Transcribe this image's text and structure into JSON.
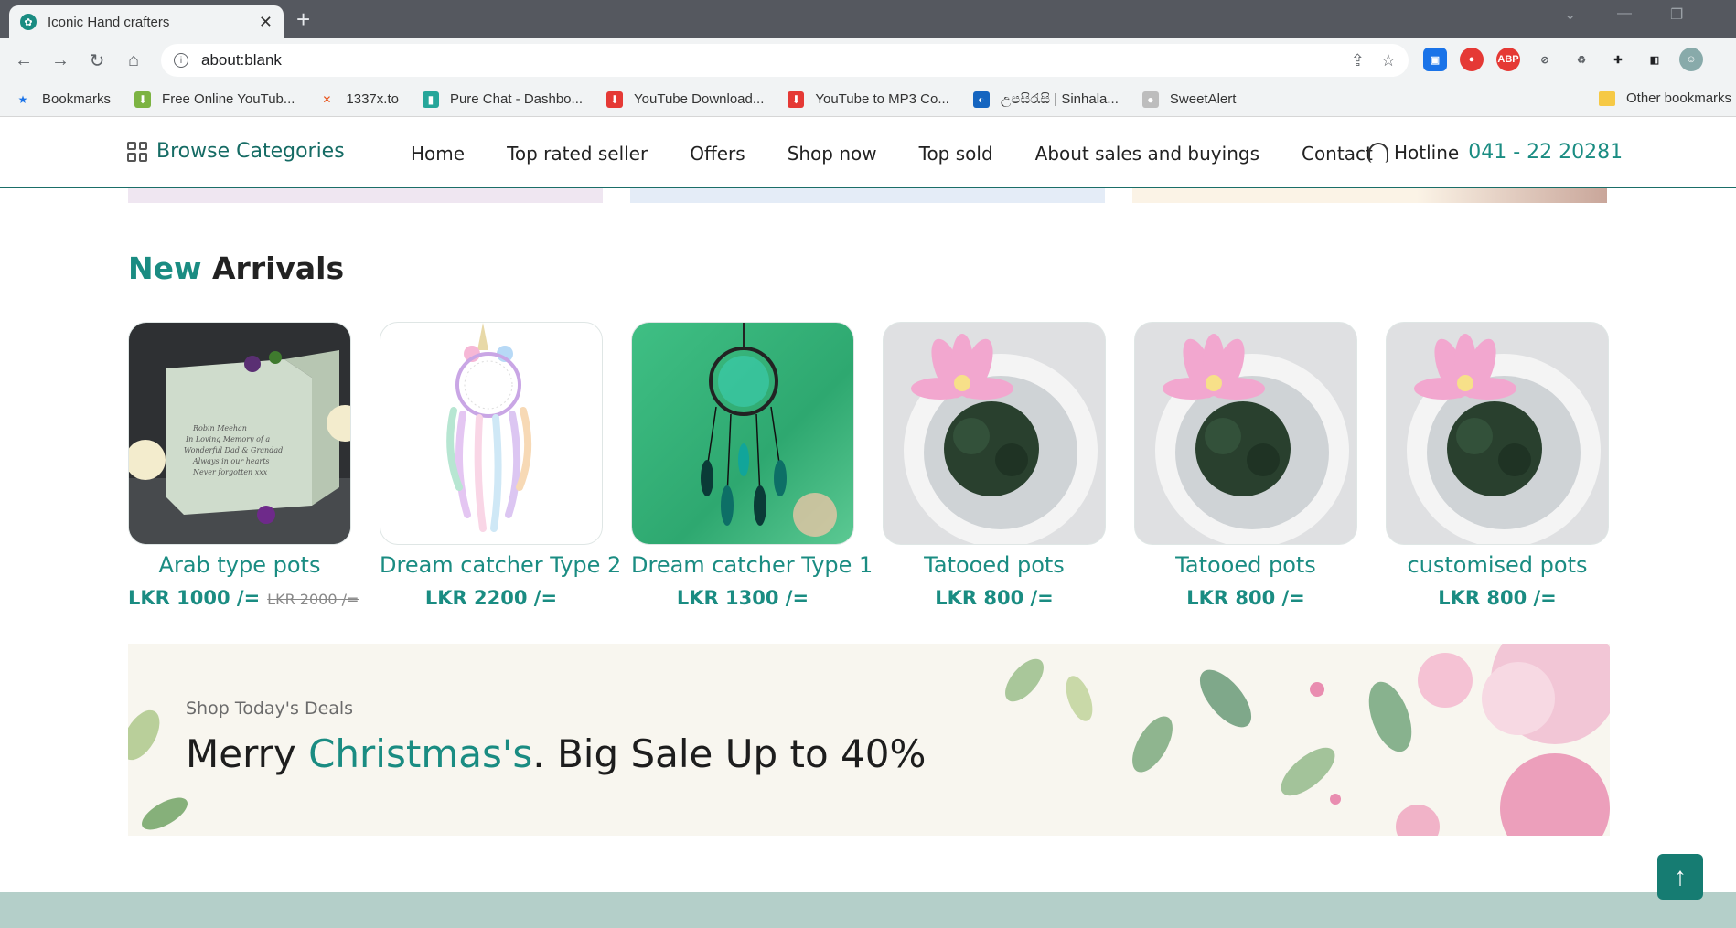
{
  "browser": {
    "tab_title": "Iconic Hand crafters",
    "url": "about:blank",
    "bookmarks": [
      {
        "label": "Bookmarks",
        "icon": "star-icon",
        "color": "#1a73e8"
      },
      {
        "label": "Free Online YouTub...",
        "icon": "download-icon",
        "color": "#7cb342"
      },
      {
        "label": "1337x.to",
        "icon": "x-icon",
        "color": "#e8541c"
      },
      {
        "label": "Pure Chat - Dashbo...",
        "icon": "chat-icon",
        "color": "#26a69a"
      },
      {
        "label": "YouTube Download...",
        "icon": "download-icon",
        "color": "#e53935"
      },
      {
        "label": "YouTube to MP3 Co...",
        "icon": "download-icon",
        "color": "#e53935"
      },
      {
        "label": "උපසිරැසි | Sinhala...",
        "icon": "site-icon",
        "color": "#1565c0"
      },
      {
        "label": "SweetAlert",
        "icon": "globe-icon",
        "color": "#bdbdbd"
      }
    ],
    "other_bookmarks": "Other bookmarks"
  },
  "header": {
    "browse_label": "Browse Categories",
    "nav": [
      "Home",
      "Top rated seller",
      "Offers",
      "Shop now",
      "Top sold",
      "About sales and buyings",
      "Contact"
    ],
    "hotline_label": "Hotline",
    "hotline_number": "041 - 22 20281"
  },
  "arrivals": {
    "title_accent": "New",
    "title_rest": "Arrivals",
    "products": [
      {
        "name": "Arab type pots",
        "price": "LKR 1000 /=",
        "old_price": "LKR 2000 /="
      },
      {
        "name": "Dream catcher Type 2",
        "price": "LKR 2200 /=",
        "old_price": ""
      },
      {
        "name": "Dream catcher Type 1",
        "price": "LKR 1300 /=",
        "old_price": ""
      },
      {
        "name": "Tatooed pots",
        "price": "LKR 800 /=",
        "old_price": ""
      },
      {
        "name": "Tatooed pots",
        "price": "LKR 800 /=",
        "old_price": ""
      },
      {
        "name": "customised pots",
        "price": "LKR 800 /=",
        "old_price": ""
      }
    ]
  },
  "deals": {
    "kicker": "Shop Today's Deals",
    "headline_a": "Merry ",
    "headline_accent": "Christmas's",
    "headline_b": ". Big Sale Up to 40%"
  },
  "colors": {
    "accent": "#1a8c82",
    "footer": "#b4cfc9"
  }
}
